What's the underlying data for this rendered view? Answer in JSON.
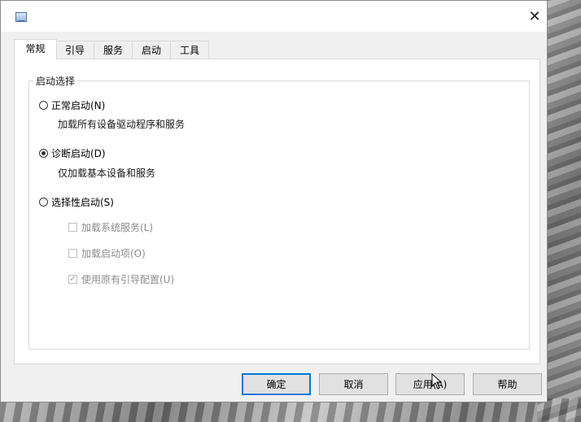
{
  "dialog": {
    "close_glyph": "✕",
    "tabs": [
      {
        "label": "常规",
        "active": true
      },
      {
        "label": "引导",
        "active": false
      },
      {
        "label": "服务",
        "active": false
      },
      {
        "label": "启动",
        "active": false
      },
      {
        "label": "工具",
        "active": false
      }
    ],
    "startup_selection": {
      "legend": "启动选择",
      "normal": {
        "label": "正常启动(N)",
        "desc": "加载所有设备驱动程序和服务",
        "selected": false
      },
      "diagnostic": {
        "label": "诊断启动(D)",
        "desc": "仅加载基本设备和服务",
        "selected": true
      },
      "selective": {
        "label": "选择性启动(S)",
        "selected": false
      },
      "options": [
        {
          "label": "加载系统服务(L)",
          "checked": false,
          "enabled": false
        },
        {
          "label": "加载启动项(O)",
          "checked": false,
          "enabled": false
        },
        {
          "label": "使用原有引导配置(U)",
          "checked": true,
          "enabled": false
        }
      ]
    },
    "buttons": {
      "ok": "确定",
      "cancel": "取消",
      "apply": "应用(A)",
      "help": "帮助"
    }
  },
  "colors": {
    "accent": "#0078d7",
    "dialog_bg": "#f0f0f0",
    "disabled_text": "#8c8c8c"
  }
}
